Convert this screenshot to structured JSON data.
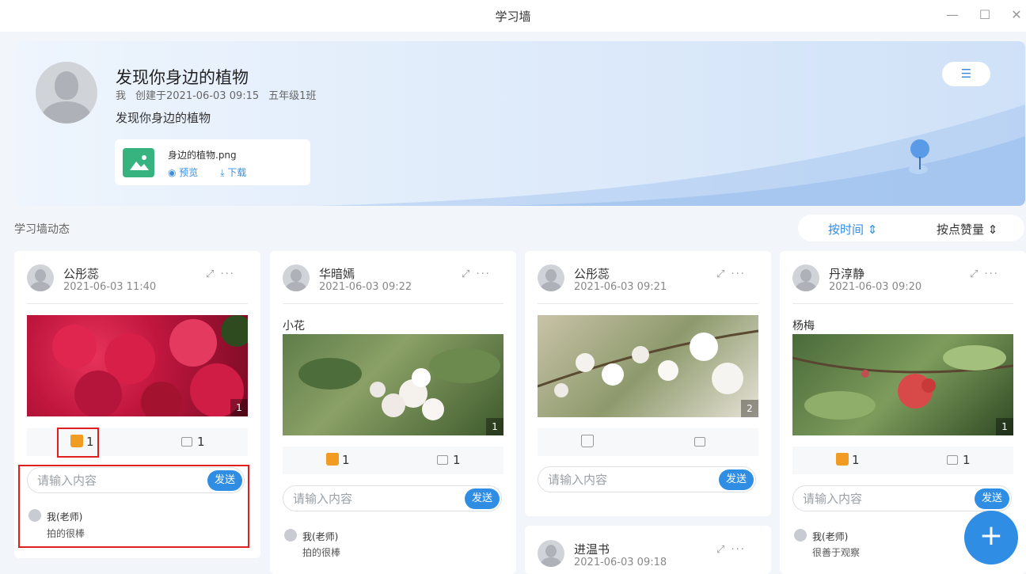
{
  "window": {
    "title": "学习墙",
    "min": "—",
    "max": "☐",
    "close": "✕"
  },
  "banner": {
    "title": "发现你身边的植物",
    "author": "我",
    "created": "创建于2021-06-03 09:15",
    "class_name": "五年级1班",
    "description": "发现你身边的植物",
    "file": {
      "name": "身边的植物.png",
      "preview": "预览",
      "download": "下载"
    },
    "menu_icon": "list-icon"
  },
  "section": {
    "title": "学习墙动态"
  },
  "sort": {
    "by_time": "按时间",
    "by_likes": "按点赞量"
  },
  "cards": [
    {
      "user": "公彤蕊",
      "time": "2021-06-03 11:40",
      "caption": "",
      "photo_count": "1",
      "likes": "1",
      "comments": "1",
      "liked": true,
      "input_placeholder": "请输入内容",
      "send": "发送",
      "comment": {
        "name": "我(老师)",
        "text": "拍的很棒"
      }
    },
    {
      "user": "华暗嫣",
      "time": "2021-06-03 09:22",
      "caption": "小花",
      "photo_count": "1",
      "likes": "1",
      "comments": "1",
      "liked": true,
      "input_placeholder": "请输入内容",
      "send": "发送",
      "comment": {
        "name": "我(老师)",
        "text": "拍的很棒"
      }
    },
    {
      "user": "公彤蕊",
      "time": "2021-06-03 09:21",
      "caption": "",
      "photo_count": "2",
      "likes": "",
      "comments": "",
      "liked": false,
      "input_placeholder": "请输入内容",
      "send": "发送"
    },
    {
      "user": "丹淳静",
      "time": "2021-06-03 09:20",
      "caption": "杨梅",
      "photo_count": "1",
      "likes": "1",
      "comments": "1",
      "liked": true,
      "input_placeholder": "请输入内容",
      "send": "发送",
      "comment": {
        "name": "我(老师)",
        "text": "很善于观察"
      }
    },
    {
      "user": "进温书",
      "time": "2021-06-03 09:18"
    }
  ],
  "fab": {
    "label": "+",
    "icon": "plus-icon"
  },
  "colors": {
    "accent": "#2f8de4",
    "like": "#f29b22",
    "highlight": "#e02020",
    "file_icon": "#36b37e"
  }
}
